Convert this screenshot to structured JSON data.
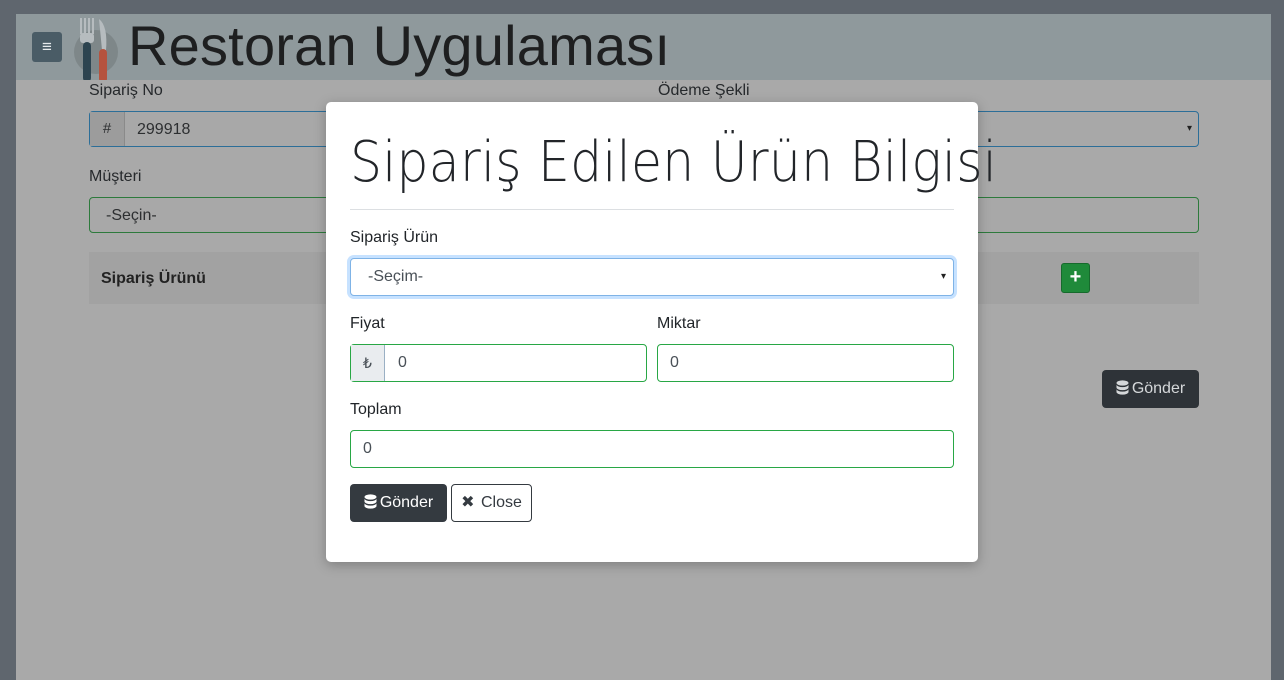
{
  "header": {
    "title": "Restoran Uygulaması",
    "menu_icon": "hamburger-icon",
    "logo_icon": "fork-knife-icon"
  },
  "form": {
    "order_no_label": "Sipariş No",
    "order_no_prefix": "#",
    "order_no_value": "299918",
    "payment_label": "Ödeme Şekli",
    "payment_value": "",
    "customer_label": "Müşteri",
    "customer_value": "-Seçin-",
    "right_field_value": "",
    "order_item_header": "Sipariş Ürünü",
    "add_button_icon": "plus-icon",
    "send_button_label": "Gönder"
  },
  "modal": {
    "title": "Sipariş Edilen Ürün Bilgisi",
    "product_label": "Sipariş Ürün",
    "product_value": "-Seçim-",
    "price_label": "Fiyat",
    "price_prefix": "₺",
    "price_value": "0",
    "quantity_label": "Miktar",
    "quantity_value": "0",
    "total_label": "Toplam",
    "total_value": "0",
    "send_label": "Gönder",
    "close_label": "Close"
  },
  "colors": {
    "overlay": "#5f666e",
    "header": "#8f999c",
    "primary_dark": "#343a40",
    "success": "#28a745",
    "focus_blue": "#7fb3e6"
  }
}
